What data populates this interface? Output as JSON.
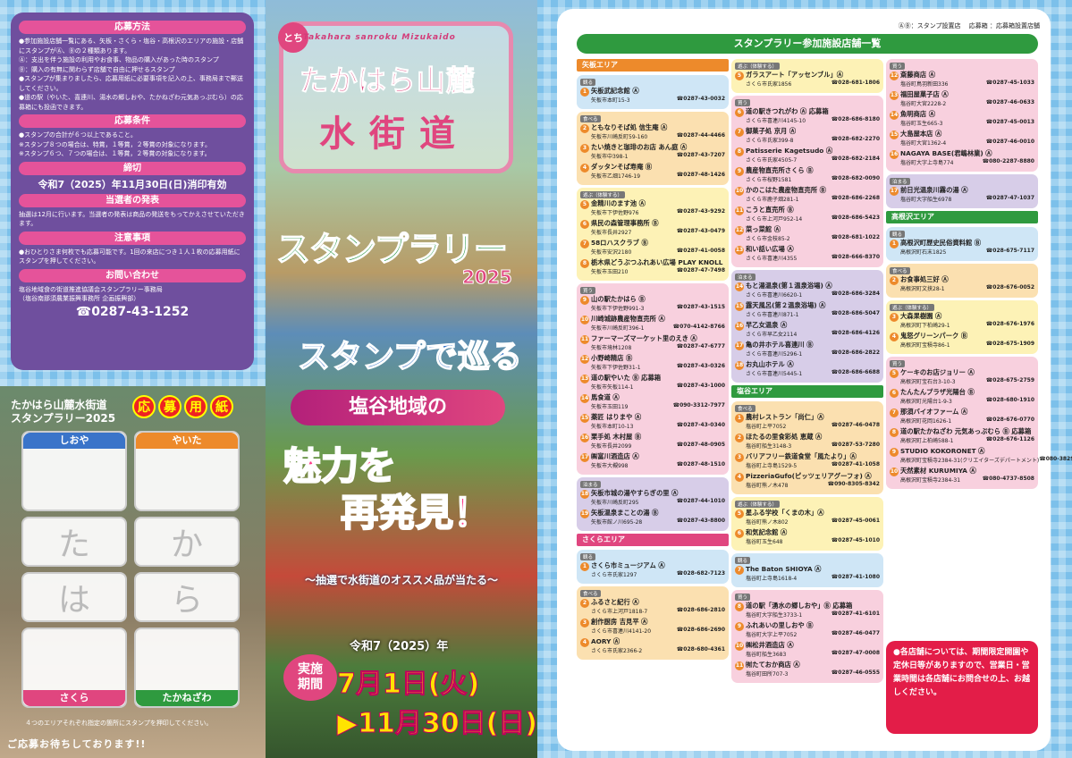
{
  "left": {
    "sections": [
      {
        "heading": "応募方法",
        "text": "●参加施設店舗一覧にある、矢板・さくら・塩谷・高根沢のエリアの施設・店舗にスタンプがⒶ、Ⓑの２種類あります。\nⒶ：支出を伴う施設の利用やお食事、物品の購入があった時のスタンプ\nⒷ：購入の有無に関わらず店舗で自由に押せるスタンプ\n●スタンプが集まりましたら、応募用紙に必要事項を記入の上、事務局まで郵送してください。\n●道の駅（やいた、喜連川、湯水の郷しおや、たかねざわ元気あっぷむら）の応募箱にも投函できます。"
      },
      {
        "heading": "応募条件",
        "text": "●スタンプの合計が６つ以上であること。\n※スタンプ８つの場合は、特賞，１等賞，２等賞の対象になります。\n※スタンプ６つ、７つの場合は、１等賞，２等賞の対象になります。"
      },
      {
        "heading": "締切",
        "big": "令和7（2025）年11月30日(日)消印有効"
      },
      {
        "heading": "当選者の発表",
        "text": "抽選は12月に行います。当選者の発表は商品の発送をもってかえさせていただきます。"
      },
      {
        "heading": "注意事項",
        "text": "●おひとりさま何枚でも応募可能です。1回の来店につき１人１枚の応募用紙にスタンプを押してください。"
      },
      {
        "heading": "お問い合わせ",
        "text": "塩谷地域食の街道推進協議会スタンプラリー事務局\n（塩谷南那須農業振興事務所 企画振興部）",
        "tel": "☎0287-43-1252"
      }
    ],
    "form": {
      "title": "たかはら山麓水街道\nスタンプラリー2025",
      "oubo": [
        "応",
        "募",
        "用",
        "紙"
      ],
      "boxes": [
        "しおや",
        "やいた",
        "た",
        "か",
        "は",
        "ら",
        "さくら",
        "たかねざわ"
      ],
      "note": "４つのエリアそれぞれ指定の箇所にスタンプを押印してください。",
      "bottom": "ご応募お待ちしております!!"
    }
  },
  "mid": {
    "romaji": "Takahara sanroku Mizukaido",
    "tochi": "とち",
    "logo_line1": "たかはら山麓",
    "logo_line2": "水街道",
    "title": "スタンプラリー",
    "year": "2025",
    "meguru": "スタンプで巡る",
    "chiiki": "塩谷地域の",
    "miryoku1": "魅力を",
    "miryoku2": "再発見！",
    "chusen": "～抽選で水街道のオススメ品が当たる～",
    "period_label": "実施\n期間",
    "period_year": "令和7（2025）年",
    "start": "7月1日(火)",
    "end": "▶11月30日(日)"
  },
  "right": {
    "legend": "ⒶⒷ：スタンプ設置店　 応募箱 ：応募箱設置店舗",
    "title": "スタンプラリー参加施設店舗一覧",
    "note": "●各店舗については、期間限定開園や定休日等がありますので、営業日・営業時間は各店舗にお問合せの上、お越しください。",
    "col1": [
      {
        "area": "矢板エリア",
        "groups": [
          {
            "label": "観る",
            "bg": "bg-see",
            "items": [
              {
                "no": "1",
                "name": "矢板武記念館 Ⓐ",
                "addr": "矢板市本町15-3",
                "tel": "☎0287-43-0032"
              }
            ]
          },
          {
            "label": "食べる",
            "bg": "bg-eat",
            "items": [
              {
                "no": "2",
                "name": "ともなりそば処 信生庵 Ⓐ",
                "addr": "矢板市川崎反町59-160",
                "tel": "☎0287-44-4466"
              },
              {
                "no": "3",
                "name": "たい焼きと珈琲のお店 あん庭 Ⓐ",
                "addr": "矢板市中398-1",
                "tel": "☎0287-43-7207"
              },
              {
                "no": "4",
                "name": "ダッタンそば寿庵 Ⓑ",
                "addr": "矢板市乙畑1746-19",
                "tel": "☎0287-48-1426"
              }
            ]
          },
          {
            "label": "遊ぶ（体験する）",
            "bg": "bg-play",
            "items": [
              {
                "no": "5",
                "name": "金精川のます池 Ⓐ",
                "addr": "矢板市下伊佐野976",
                "tel": "☎0287-43-9292"
              },
              {
                "no": "6",
                "name": "県民の森管理事務所 Ⓑ",
                "addr": "矢板市長井2927",
                "tel": "☎0287-43-0479"
              },
              {
                "no": "7",
                "name": "58ロハスクラブ Ⓑ",
                "addr": "矢板市安沢2180",
                "tel": "☎0287-41-0058"
              },
              {
                "no": "8",
                "name": "栃木県どうぶつふれあい広場 PLAY KNOLL Ⓐ",
                "addr": "矢板市玉田210",
                "tel": "☎0287-47-7498"
              }
            ]
          },
          {
            "label": "買う",
            "bg": "bg-buy",
            "items": [
              {
                "no": "9",
                "name": "山の駅たかはら Ⓑ",
                "addr": "矢板市下伊佐野991-3",
                "tel": "☎0287-43-1515"
              },
              {
                "no": "10",
                "name": "川崎城跡農産物直売所 Ⓐ",
                "addr": "矢板市川崎反町396-1",
                "tel": "☎070-4142-8766"
              },
              {
                "no": "11",
                "name": "ファーマーズマーケット里のえき Ⓐ",
                "addr": "矢板市境林1208",
                "tel": "☎0287-47-6777"
              },
              {
                "no": "12",
                "name": "小野崎精店 Ⓑ",
                "addr": "矢板市下伊佐野31-1",
                "tel": "☎0287-43-0326"
              },
              {
                "no": "13",
                "name": "道の駅やいた Ⓑ 応募箱",
                "addr": "矢板市矢板114-1",
                "tel": "☎0287-43-1000"
              },
              {
                "no": "14",
                "name": "馬食道 Ⓐ",
                "addr": "矢板市玉田119",
                "tel": "☎090-3312-7977"
              },
              {
                "no": "15",
                "name": "薬匠 はりまや Ⓐ",
                "addr": "矢板市本町10-13",
                "tel": "☎0287-43-0340"
              },
              {
                "no": "16",
                "name": "栗手処 木村屋 Ⓑ",
                "addr": "矢板市長井2099",
                "tel": "☎0287-48-0905"
              },
              {
                "no": "17",
                "name": "㈱富川酒造店 Ⓐ",
                "addr": "矢板市大槻998",
                "tel": "☎0287-48-1510"
              }
            ]
          },
          {
            "label": "泊まる",
            "bg": "bg-stay",
            "items": [
              {
                "no": "18",
                "name": "矢板市城の湯やすらぎの里 Ⓐ",
                "addr": "矢板市川崎反町295",
                "tel": "☎0287-44-1010"
              },
              {
                "no": "19",
                "name": "矢板温泉まことの湯 Ⓑ",
                "addr": "矢板市館ノ川695-28",
                "tel": "☎0287-43-8800"
              }
            ]
          }
        ]
      },
      {
        "area": "さくらエリア",
        "groups": [
          {
            "label": "観る",
            "bg": "bg-see",
            "items": [
              {
                "no": "1",
                "name": "さくら市ミュージアム Ⓐ",
                "addr": "さくら市氏家1297",
                "tel": "☎028-682-7123"
              }
            ]
          },
          {
            "label": "食べる",
            "bg": "bg-eat",
            "items": [
              {
                "no": "2",
                "name": "ふるさと紀行 Ⓐ",
                "addr": "さくら市上河戸1818-7",
                "tel": "☎028-686-2810"
              },
              {
                "no": "3",
                "name": "創作厨房 吉見平 Ⓐ",
                "addr": "さくら市喜連川4141-20",
                "tel": "☎028-686-2690"
              },
              {
                "no": "4",
                "name": "AORY Ⓐ",
                "addr": "さくら市氏家2366-2",
                "tel": "☎028-680-4361"
              }
            ]
          }
        ]
      }
    ],
    "col2": [
      {
        "area": "",
        "groups": [
          {
            "label": "遊ぶ（体験する）",
            "bg": "bg-play",
            "items": [
              {
                "no": "5",
                "name": "ガラスアート「アッセンブル」Ⓐ",
                "addr": "さくら市氏家1856",
                "tel": "☎028-681-1806"
              }
            ]
          },
          {
            "label": "買う",
            "bg": "bg-buy",
            "items": [
              {
                "no": "6",
                "name": "道の駅きつれがわ Ⓐ 応募箱",
                "addr": "さくら市喜連川4145-10",
                "tel": "☎028-686-8180"
              },
              {
                "no": "7",
                "name": "御菓子処 京月 Ⓐ",
                "addr": "さくら市氏家399-8",
                "tel": "☎028-682-2270"
              },
              {
                "no": "8",
                "name": "Patisserie Kagetsudo Ⓐ",
                "addr": "さくら市氏家4505-7",
                "tel": "☎028-682-2184"
              },
              {
                "no": "9",
                "name": "農産物直売所さくら Ⓑ",
                "addr": "さくら市桜野1581",
                "tel": "☎028-682-0090"
              },
              {
                "no": "10",
                "name": "かのこはた農産物直売所 Ⓑ",
                "addr": "さくら市鹿子畑281-1",
                "tel": "☎028-686-2268"
              },
              {
                "no": "11",
                "name": "こうと直売所 Ⓑ",
                "addr": "さくら市上河戸952-14",
                "tel": "☎028-686-5423"
              },
              {
                "no": "12",
                "name": "菜っ菜館 Ⓐ",
                "addr": "さくら市金枝85-2",
                "tel": "☎028-681-1022"
              },
              {
                "no": "13",
                "name": "和い話い広場 Ⓐ",
                "addr": "さくら市喜連川4355",
                "tel": "☎028-666-8370"
              }
            ]
          },
          {
            "label": "泊まる",
            "bg": "bg-stay",
            "items": [
              {
                "no": "14",
                "name": "もと湯温泉(第１温泉浴場) Ⓐ",
                "addr": "さくら市喜連川6620-1",
                "tel": "☎028-686-3284"
              },
              {
                "no": "15",
                "name": "露天風呂(第２温泉浴場) Ⓐ",
                "addr": "さくら市喜連川871-1",
                "tel": "☎028-686-5047"
              },
              {
                "no": "16",
                "name": "早乙女温泉 Ⓐ",
                "addr": "さくら市早乙女2114",
                "tel": "☎028-686-4126"
              },
              {
                "no": "17",
                "name": "亀の井ホテル喜連川 Ⓑ",
                "addr": "さくら市喜連川5296-1",
                "tel": "☎028-686-2822"
              },
              {
                "no": "18",
                "name": "お丸山ホテル Ⓐ",
                "addr": "さくら市喜連川5445-1",
                "tel": "☎028-686-6688"
              }
            ]
          }
        ]
      },
      {
        "area": "塩谷エリア",
        "groups": [
          {
            "label": "食べる",
            "bg": "bg-eat",
            "items": [
              {
                "no": "1",
                "name": "農村レストラン「尚仁」Ⓐ",
                "addr": "塩谷町上平7052",
                "tel": "☎0287-46-0478"
              },
              {
                "no": "2",
                "name": "ほたるの里食彩処 恵蔵 Ⓐ",
                "addr": "塩谷町船生3148-3",
                "tel": "☎0287-53-7280"
              },
              {
                "no": "3",
                "name": "バリアフリー鉄道食堂「風たより」Ⓐ",
                "addr": "塩谷町上寺島1529-5",
                "tel": "☎0287-41-1058"
              },
              {
                "no": "4",
                "name": "PizzeriaGufo(ピッツェリアグーフォ) Ⓐ",
                "addr": "塩谷町熊ノ木478",
                "tel": "☎090-8305-8342"
              }
            ]
          },
          {
            "label": "遊ぶ（体験する）",
            "bg": "bg-play",
            "items": [
              {
                "no": "5",
                "name": "星ふる学校「くまの木」Ⓐ",
                "addr": "塩谷町熊ノ木802",
                "tel": "☎0287-45-0061"
              },
              {
                "no": "6",
                "name": "和気記念館 Ⓐ",
                "addr": "塩谷町玉生648",
                "tel": "☎0287-45-1010"
              }
            ]
          },
          {
            "label": "観る",
            "bg": "bg-see",
            "items": [
              {
                "no": "7",
                "name": "The Baton SHIOYA Ⓐ",
                "addr": "塩谷町上寺島1618-4",
                "tel": "☎0287-41-1080"
              }
            ]
          },
          {
            "label": "買う",
            "bg": "bg-buy",
            "items": [
              {
                "no": "8",
                "name": "道の駅「湧水の郷しおや」Ⓑ 応募箱",
                "addr": "塩谷町大字船生3733-1",
                "tel": "☎0287-41-6101"
              },
              {
                "no": "9",
                "name": "ふれあいの里しおや Ⓑ",
                "addr": "塩谷町大字上平7052",
                "tel": "☎0287-46-0477"
              },
              {
                "no": "10",
                "name": "㈱松井酒造店 Ⓐ",
                "addr": "塩谷町船生3683",
                "tel": "☎0287-47-0008"
              },
              {
                "no": "11",
                "name": "㈲たておか商店 Ⓐ",
                "addr": "塩谷町田所707-3",
                "tel": "☎0287-46-0555"
              }
            ]
          }
        ]
      }
    ],
    "col3": [
      {
        "area": "",
        "groups": [
          {
            "label": "買う",
            "bg": "bg-buy",
            "items": [
              {
                "no": "12",
                "name": "斎藤商店 Ⓐ",
                "addr": "塩谷町鳥羽新田336",
                "tel": "☎0287-45-1033"
              },
              {
                "no": "13",
                "name": "福田屋菓子店 Ⓐ",
                "addr": "塩谷町大宮2228-2",
                "tel": "☎0287-46-0633"
              },
              {
                "no": "14",
                "name": "魚明商店 Ⓐ",
                "addr": "塩谷町玉生665-3",
                "tel": "☎0287-45-0013"
              },
              {
                "no": "15",
                "name": "大島屋本店 Ⓐ",
                "addr": "塩谷町大宮1362-4",
                "tel": "☎0287-46-0010"
              },
              {
                "no": "16",
                "name": "NAGAYA BASE(君嶋林業) Ⓐ",
                "addr": "塩谷町大字上寺島774",
                "tel": "☎080-2287-8880"
              }
            ]
          },
          {
            "label": "泊まる",
            "bg": "bg-stay",
            "items": [
              {
                "no": "17",
                "name": "前日光温泉川霧の湯 Ⓐ",
                "addr": "塩谷町大字船生6978",
                "tel": "☎0287-47-1037"
              }
            ]
          }
        ]
      },
      {
        "area": "高根沢エリア",
        "groups": [
          {
            "label": "観る",
            "bg": "bg-see",
            "items": [
              {
                "no": "1",
                "name": "高根沢町歴史民俗資料館 Ⓑ",
                "addr": "高根沢町石末1825",
                "tel": "☎028-675-7117"
              }
            ]
          },
          {
            "label": "食べる",
            "bg": "bg-eat",
            "items": [
              {
                "no": "2",
                "name": "お食事処三好 Ⓐ",
                "addr": "高根沢町文挟28-1",
                "tel": "☎028-676-0052"
              }
            ]
          },
          {
            "label": "遊ぶ（体験する）",
            "bg": "bg-play",
            "items": [
              {
                "no": "3",
                "name": "大森果樹園 Ⓐ",
                "addr": "高根沢町下柏崎29-1",
                "tel": "☎028-676-1976"
              },
              {
                "no": "4",
                "name": "鬼怒グリーンパーク Ⓑ",
                "addr": "高根沢町宝積寺86-1",
                "tel": "☎028-675-1909"
              }
            ]
          },
          {
            "label": "買う",
            "bg": "bg-buy",
            "items": [
              {
                "no": "5",
                "name": "ケーキのお店ジョリー Ⓐ",
                "addr": "高根沢町宝石台3-10-3",
                "tel": "☎028-675-2759"
              },
              {
                "no": "6",
                "name": "たんたんプラザ光陽台 Ⓑ",
                "addr": "高根沢町光陽台1-9-3",
                "tel": "☎028-680-1910"
              },
              {
                "no": "7",
                "name": "那須バイオファーム Ⓐ",
                "addr": "高根沢町花岡1626-1",
                "tel": "☎028-676-0770"
              },
              {
                "no": "8",
                "name": "道の駅たかねざわ 元気あっぷむら Ⓑ 応募箱",
                "addr": "高根沢町上柏崎588-1",
                "tel": "☎028-676-1126"
              },
              {
                "no": "9",
                "name": "STUDIO KOKORONET Ⓐ",
                "addr": "高根沢町宝積寺2384-31(クリエイターズデパートメント)",
                "tel": "☎080-3829-1606"
              },
              {
                "no": "10",
                "name": "天然素材 KURUMIYA Ⓐ",
                "addr": "高根沢町宝積寺2384-31",
                "tel": "☎080-4737-8508"
              }
            ]
          }
        ]
      }
    ]
  }
}
